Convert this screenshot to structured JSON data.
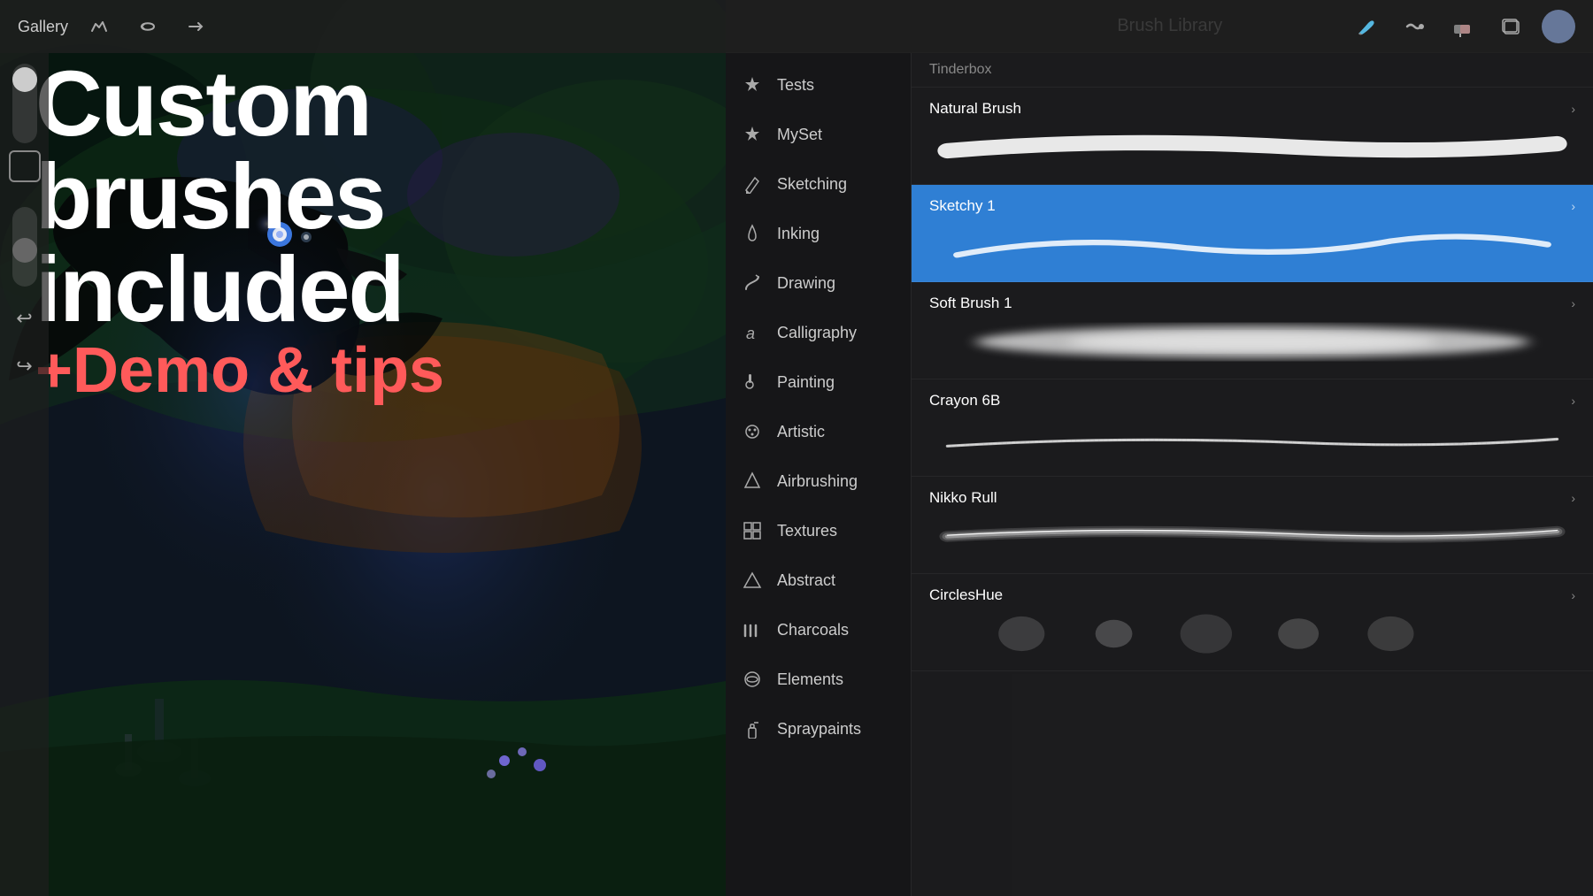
{
  "toolbar": {
    "gallery_label": "Gallery",
    "add_label": "+",
    "title": "Brush Library"
  },
  "overlay": {
    "main_title": "Custom brushes included",
    "sub_title": "+Demo & tips"
  },
  "categories": [
    {
      "id": "tests",
      "label": "Tests",
      "icon": "✦"
    },
    {
      "id": "myset",
      "label": "MySet",
      "icon": "✦"
    },
    {
      "id": "sketching",
      "label": "Sketching",
      "icon": "✐"
    },
    {
      "id": "inking",
      "label": "Inking",
      "icon": "💧"
    },
    {
      "id": "drawing",
      "label": "Drawing",
      "icon": "↺"
    },
    {
      "id": "calligraphy",
      "label": "Calligraphy",
      "icon": "𝒶"
    },
    {
      "id": "painting",
      "label": "Painting",
      "icon": "🖌"
    },
    {
      "id": "artistic",
      "label": "Artistic",
      "icon": "🎨"
    },
    {
      "id": "airbrushing",
      "label": "Airbrushing",
      "icon": "△"
    },
    {
      "id": "textures",
      "label": "Textures",
      "icon": "▦"
    },
    {
      "id": "abstract",
      "label": "Abstract",
      "icon": "△"
    },
    {
      "id": "charcoals",
      "label": "Charcoals",
      "icon": "⦁⦁⦁"
    },
    {
      "id": "elements",
      "label": "Elements",
      "icon": "☯"
    },
    {
      "id": "spraypaints",
      "label": "Spraypaints",
      "icon": "🗑"
    }
  ],
  "brush_list_header": "Tinderbox",
  "brushes": [
    {
      "id": "natural-brush",
      "name": "Natural Brush",
      "selected": false,
      "preview_type": "stroke_wide"
    },
    {
      "id": "sketchy-1",
      "name": "Sketchy 1",
      "selected": true,
      "preview_type": "stroke_curved"
    },
    {
      "id": "soft-brush-1",
      "name": "Soft Brush 1",
      "selected": false,
      "preview_type": "stroke_soft"
    },
    {
      "id": "crayon-6b",
      "name": "Crayon 6B",
      "selected": false,
      "preview_type": "stroke_thin"
    },
    {
      "id": "nikko-rull",
      "name": "Nikko Rull",
      "selected": false,
      "preview_type": "stroke_textured"
    },
    {
      "id": "circles-hue",
      "name": "CirclesHue",
      "selected": false,
      "preview_type": "stroke_circles"
    }
  ],
  "colors": {
    "accent_blue": "#2f7fd4",
    "text_primary": "#ffffff",
    "text_secondary": "#cccccc",
    "text_muted": "#888888",
    "panel_bg": "#1c1c1e",
    "selected_blue": "#2f7fd4",
    "sub_title_red": "#ff5a5a"
  }
}
